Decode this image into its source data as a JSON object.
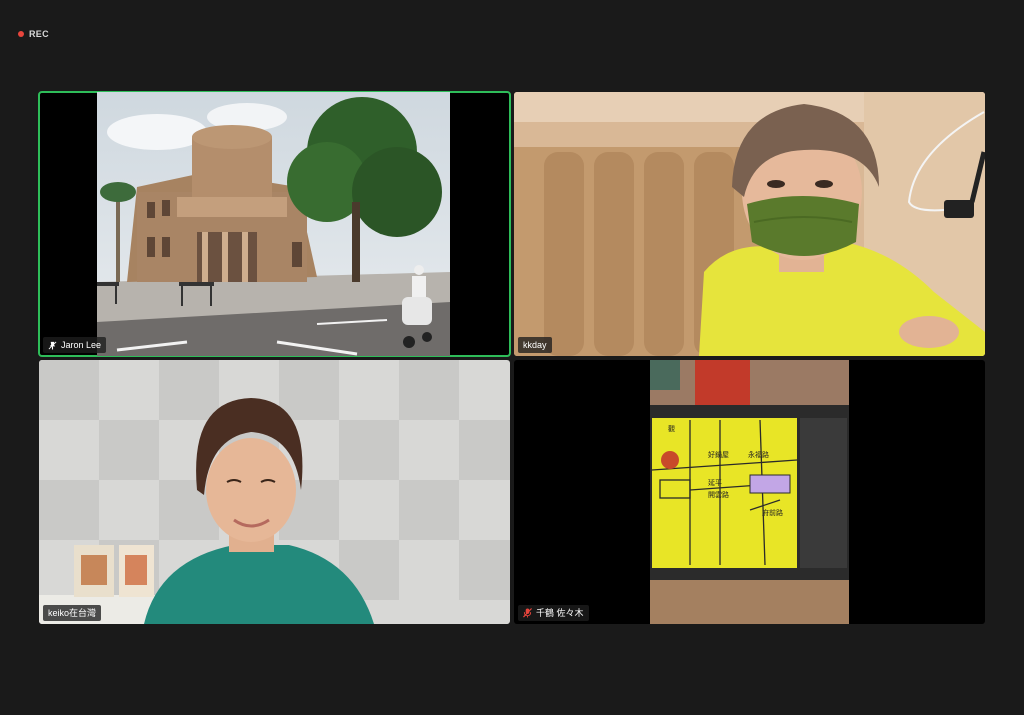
{
  "recording": {
    "label": "REC",
    "color": "#e8453c"
  },
  "tiles": [
    {
      "name": "Jaron Lee",
      "status_icon": "pin-icon",
      "active": true
    },
    {
      "name": "kkday",
      "status_icon": null,
      "active": false
    },
    {
      "name": "keiko在台灣",
      "status_icon": null,
      "active": false
    },
    {
      "name": "千鶴 佐々木",
      "status_icon": "muted-mic-icon",
      "active": false
    }
  ],
  "map_labels": [
    "觀",
    "好鍋屋",
    "永福路",
    "延平",
    "開雲路",
    "府前路"
  ],
  "colors": {
    "active_speaker": "#2ebd59",
    "background": "#1a1a1a"
  }
}
